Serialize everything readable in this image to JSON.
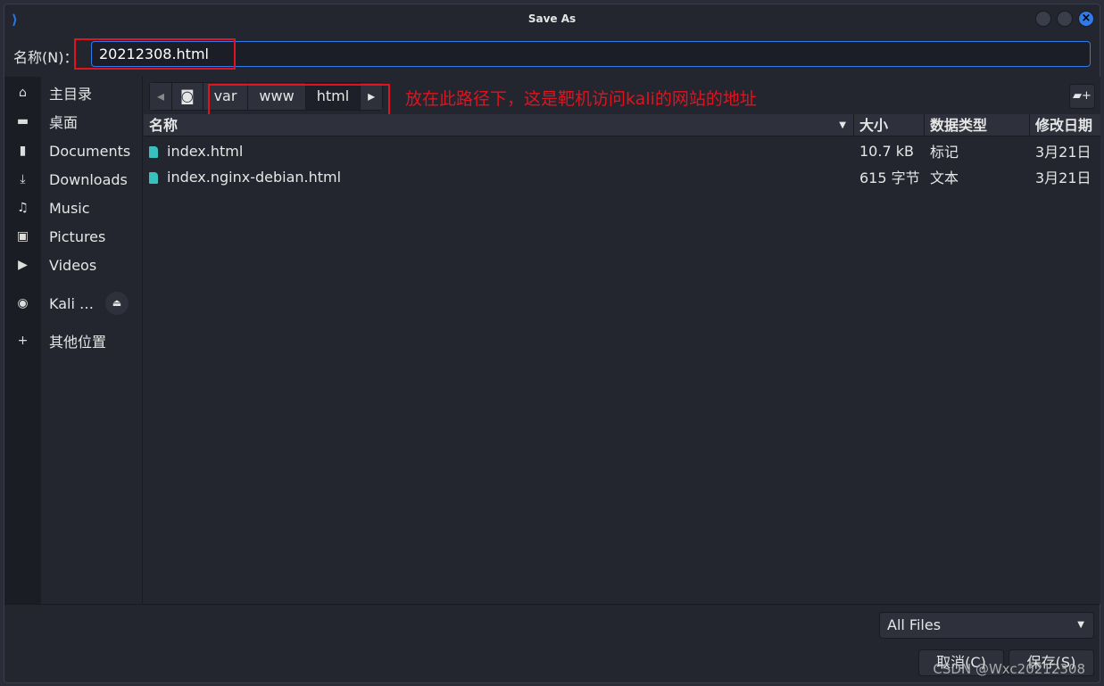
{
  "window": {
    "title": "Save As",
    "close_icon": "×"
  },
  "name_field": {
    "label": "名称(N)：",
    "value": "20212308.html"
  },
  "sidebar": {
    "items": [
      {
        "icon": "⌂",
        "label": "主目录"
      },
      {
        "icon": "▬",
        "label": "桌面"
      },
      {
        "icon": "▮",
        "label": "Documents"
      },
      {
        "icon": "⤓",
        "label": "Downloads"
      },
      {
        "icon": "♫",
        "label": "Music"
      },
      {
        "icon": "▣",
        "label": "Pictures"
      },
      {
        "icon": "▶",
        "label": "Videos"
      },
      {
        "icon": "◉",
        "label": "Kali …"
      },
      {
        "icon": "+",
        "label": "其他位置"
      }
    ],
    "eject_icon": "⏏"
  },
  "path": {
    "segments": [
      "var",
      "www",
      "html"
    ],
    "current": "html"
  },
  "annotation": "放在此路径下，这是靶机访问kali的网站的地址",
  "table": {
    "headers": [
      "名称",
      "大小",
      "数据类型",
      "修改日期"
    ],
    "rows": [
      {
        "name": "index.html",
        "size": "10.7 kB",
        "type": "标记",
        "date": "3月21日"
      },
      {
        "name": "index.nginx-debian.html",
        "size": "615 字节",
        "type": "文本",
        "date": "3月21日"
      }
    ]
  },
  "filter": {
    "value": "All Files"
  },
  "buttons": {
    "cancel": "取消(C)",
    "save": "保存(S)"
  },
  "watermark": "CSDN @Wxc20212308",
  "colors": {
    "accent": "#2f7bea",
    "annotation": "#e0141e",
    "file_icon": "#38c0c0"
  }
}
